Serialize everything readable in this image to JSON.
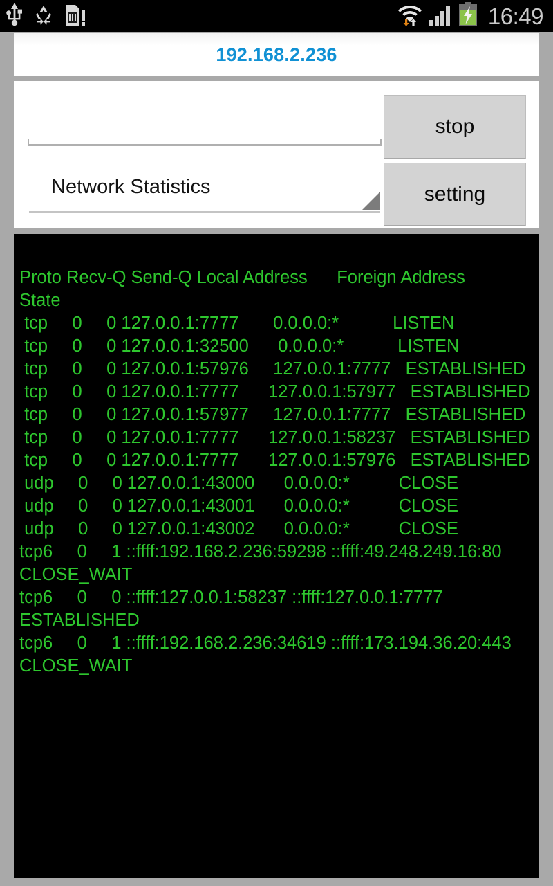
{
  "statusbar": {
    "icons_left": [
      "usb-icon",
      "recycle-icon",
      "sdcard-warning-icon"
    ],
    "icons_right": [
      "wifi-transfer-icon",
      "signal-bars-icon",
      "battery-charging-icon"
    ],
    "time": "16:49"
  },
  "titlebar": {
    "title": "192.168.2.236",
    "title_color": "#1191d4"
  },
  "controls": {
    "command_input": {
      "value": "",
      "placeholder": ""
    },
    "spinner": {
      "selected": "Network Statistics",
      "options": [
        "Network Statistics"
      ]
    },
    "buttons": {
      "stop": "stop",
      "setting": "setting"
    }
  },
  "terminal": {
    "text_color": "#2ec62e",
    "background_color": "#000000",
    "lines": [
      "Proto Recv-Q Send-Q Local Address      Foreign Address      State",
      " tcp     0     0 127.0.0.1:7777       0.0.0.0:*           LISTEN",
      " tcp     0     0 127.0.0.1:32500      0.0.0.0:*           LISTEN",
      " tcp     0     0 127.0.0.1:57976     127.0.0.1:7777   ESTABLISHED",
      " tcp     0     0 127.0.0.1:7777      127.0.0.1:57977   ESTABLISHED",
      " tcp     0     0 127.0.0.1:57977     127.0.0.1:7777   ESTABLISHED",
      " tcp     0     0 127.0.0.1:7777      127.0.0.1:58237   ESTABLISHED",
      " tcp     0     0 127.0.0.1:7777      127.0.0.1:57976   ESTABLISHED",
      " udp     0     0 127.0.0.1:43000      0.0.0.0:*          CLOSE",
      " udp     0     0 127.0.0.1:43001      0.0.0.0:*          CLOSE",
      " udp     0     0 127.0.0.1:43002      0.0.0.0:*          CLOSE",
      "tcp6     0     1 ::ffff:192.168.2.236:59298 ::ffff:49.248.249.16:80 CLOSE_WAIT",
      "tcp6     0     0 ::ffff:127.0.0.1:58237 ::ffff:127.0.0.1:7777 ESTABLISHED",
      "tcp6     0     1 ::ffff:192.168.2.236:34619 ::ffff:173.194.36.20:443 CLOSE_WAIT"
    ]
  }
}
